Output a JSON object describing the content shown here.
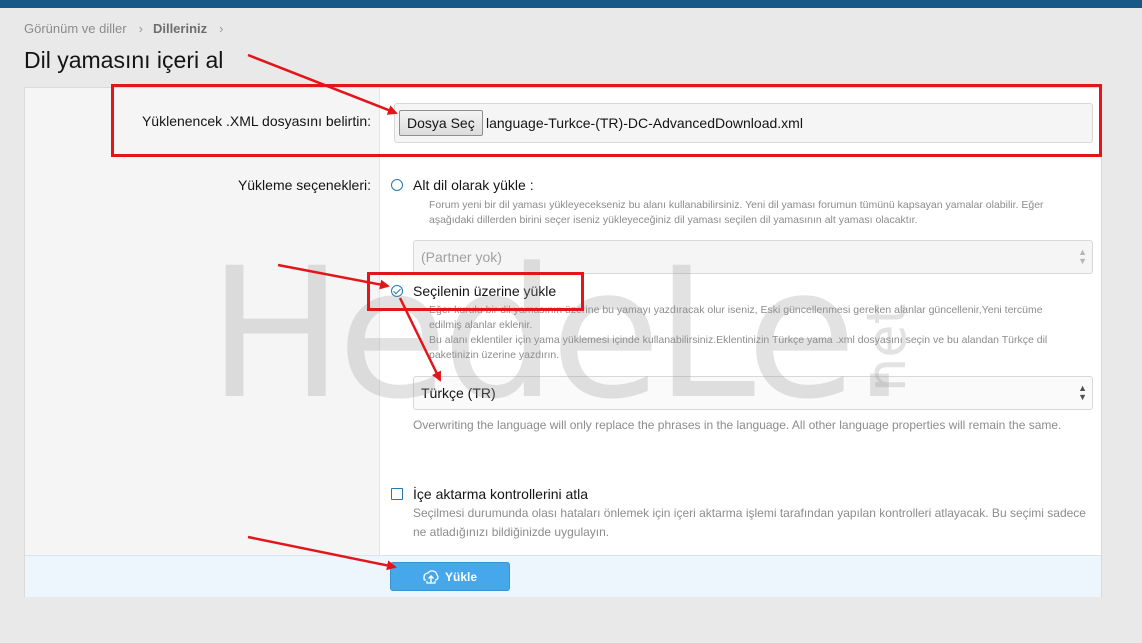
{
  "breadcrumb": {
    "items": [
      "Görünüm ve diller",
      "Dilleriniz"
    ],
    "separator": "›"
  },
  "page_title": "Dil yamasını içeri al",
  "file_row": {
    "label": "Yüklenencek .XML dosyasını belirtin:",
    "button": "Dosya Seç",
    "file_name": "language-Turkce-(TR)-DC-AdvancedDownload.xml"
  },
  "options_row": {
    "label": "Yükleme seçenekleri:",
    "child_option": {
      "label": "Alt dil olarak yükle :",
      "selected": false,
      "hint_lines": [
        "Forum yeni bir dil yaması yükleyecekseniz bu alanı kullanabilirsiniz. Yeni dil yaması forumun tümünü kapsayan yamalar olabilir. Eğer",
        "aşağıdaki dillerden birini seçer iseniz yükleyeceğiniz dil yaması seçilen dil yamasının alt yaması olacaktır."
      ],
      "select_value": "(Partner yok)"
    },
    "overwrite_option": {
      "label": "Seçilenin üzerine yükle",
      "selected": true,
      "hint_lines": [
        "Eğer kurulu bir dil yamasının üzerine bu yamayı yazdıracak olur iseniz, Eski güncellenmesi gereken alanlar güncellenir,Yeni tercüme",
        "edilmiş alanlar eklenir.",
        "Bu alanı eklentiler için yama yüklemesi içinde kullanabilirsiniz.Eklentinizin Türkçe yama .xml dosyasını seçin ve bu alandan Türkçe dil",
        "paketinizin üzerine yazdırın."
      ],
      "select_value": "Türkçe (TR)",
      "explain": "Overwriting the language will only replace the phrases in the language. All other language properties will remain the same."
    },
    "skip_checks": {
      "label": "İçe aktarma kontrollerini atla",
      "checked": false,
      "explain": "Seçilmesi durumunda olası hataları önlemek için içeri aktarma işlemi tarafından yapılan kontrolleri atlayacak. Bu seçimi sadece ne atladığınızı bildiğinizde uygulayın."
    }
  },
  "submit": {
    "label": "Yükle",
    "icon": "upload-icon"
  },
  "watermark": {
    "main": "HedeLe.",
    "suffix": "net"
  },
  "colors": {
    "header_bar": "#185886",
    "accent": "#2577b1",
    "button": "#47a7eb",
    "annotation": "#e3151a"
  }
}
